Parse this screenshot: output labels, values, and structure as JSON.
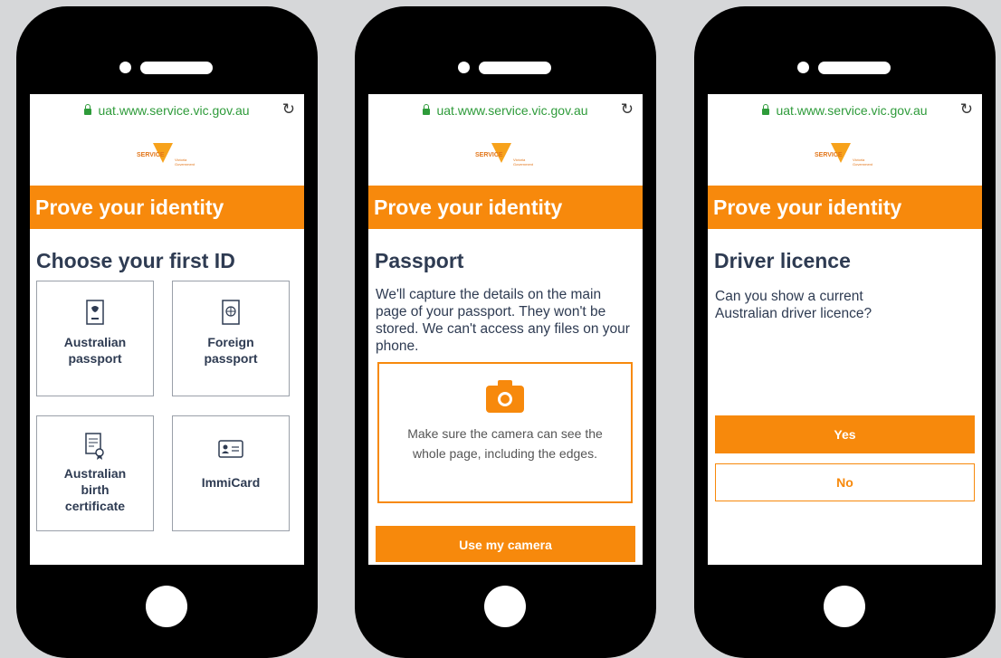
{
  "browser": {
    "url": "uat.www.service.vic.gov.au"
  },
  "logo": {
    "word": "SERVICE",
    "sub_line1": "Victoria",
    "sub_line2": "Government"
  },
  "phones": [
    {
      "banner": "Prove your identity",
      "heading": "Choose your first ID",
      "tiles": [
        {
          "label": "Australian passport",
          "icon": "passport-icon"
        },
        {
          "label": "Foreign passport",
          "icon": "globe-passport-icon"
        },
        {
          "label": "Australian birth certificate",
          "icon": "certificate-icon"
        },
        {
          "label": "ImmiCard",
          "icon": "id-card-icon"
        }
      ]
    },
    {
      "banner": "Prove your identity",
      "heading": "Passport",
      "body": "We'll capture the details on the main page of your passport. They won't be stored. We can't access any files on your phone.",
      "camera_hint": "Make sure the camera can see the whole page, including the edges.",
      "camera_icon": "camera-icon",
      "button": "Use my camera"
    },
    {
      "banner": "Prove your identity",
      "heading": "Driver licence",
      "question": "Can you show a current Australian driver licence?",
      "yes": "Yes",
      "no": "No"
    }
  ],
  "colors": {
    "accent": "#f7890c",
    "text": "#2e3b52",
    "secure": "#2e9b3a",
    "background": "#d6d7d9"
  }
}
